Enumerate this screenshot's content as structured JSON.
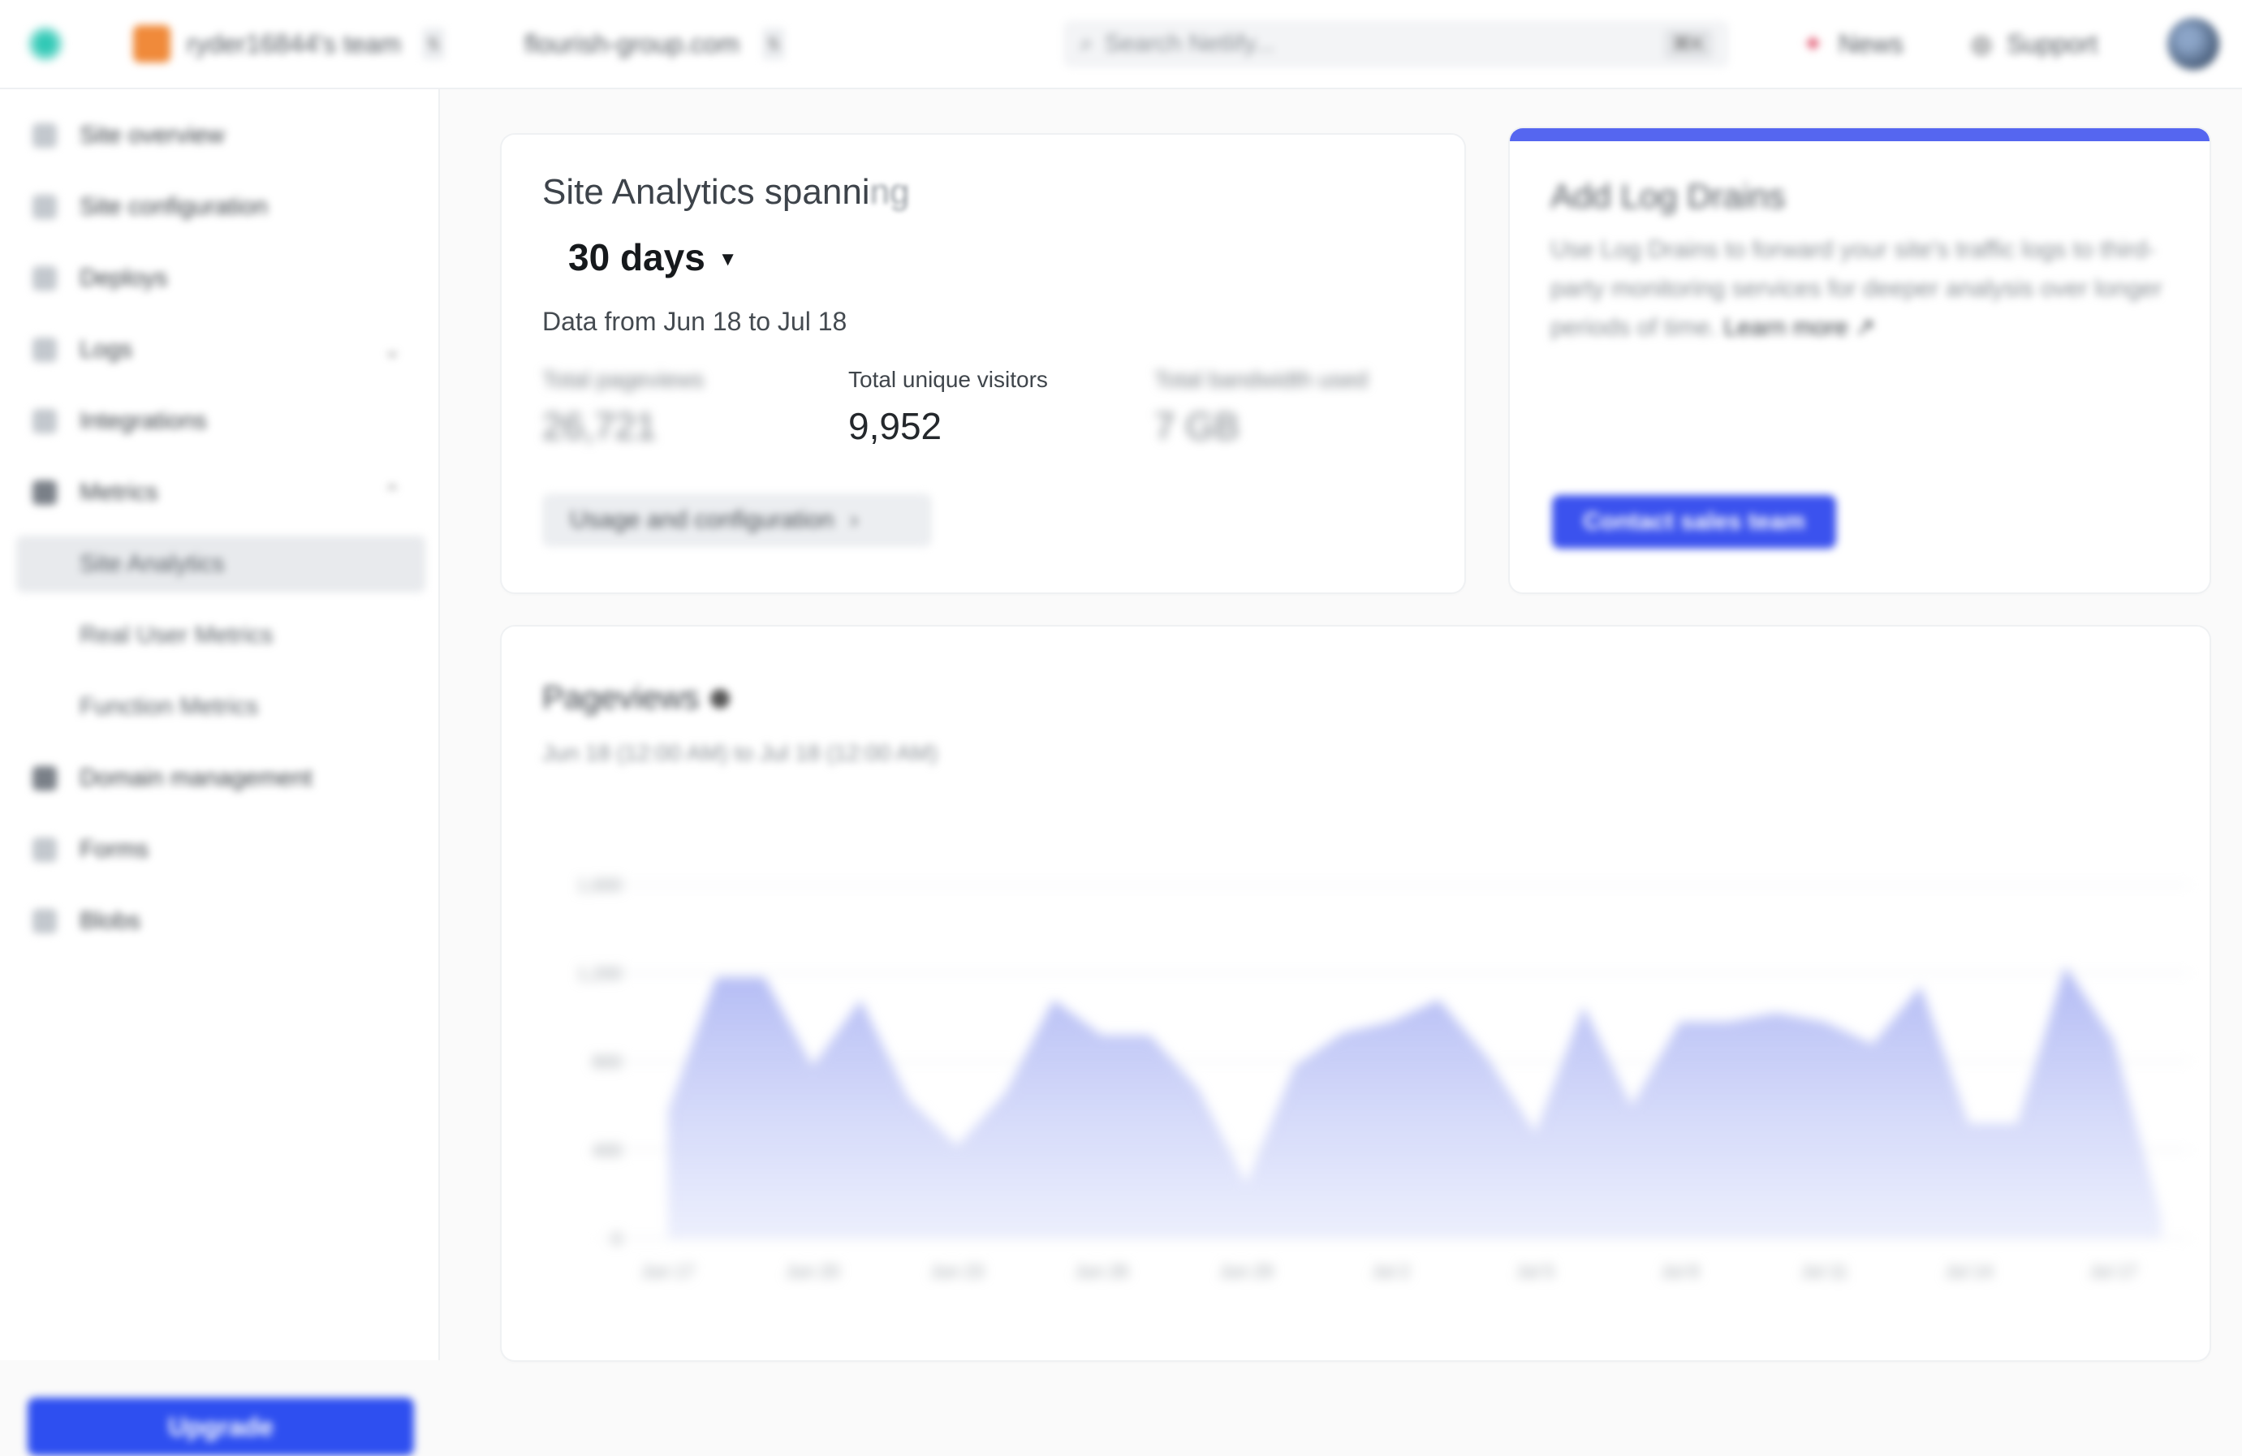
{
  "topbar": {
    "team_name": "ryder16844's team",
    "site_name": "flourish-group.com",
    "search_placeholder": "Search Netlify...",
    "search_shortcut": "⌘K",
    "news_label": "News",
    "support_label": "Support"
  },
  "sidebar": {
    "items": [
      {
        "label": "Site overview"
      },
      {
        "label": "Site configuration"
      },
      {
        "label": "Deploys"
      },
      {
        "label": "Logs"
      },
      {
        "label": "Integrations"
      },
      {
        "label": "Metrics"
      },
      {
        "label": "Site Analytics"
      },
      {
        "label": "Real User Metrics"
      },
      {
        "label": "Function Metrics"
      },
      {
        "label": "Domain management"
      },
      {
        "label": "Forms"
      },
      {
        "label": "Blobs"
      }
    ],
    "upgrade_label": "Upgrade"
  },
  "analytics": {
    "title_visible": "Site Analytics spanni",
    "title_faded": "ng",
    "range_label": "30 days",
    "subtitle": "Data from Jun 18 to Jul 18",
    "stats": [
      {
        "label": "Total pageviews",
        "value": "26,721"
      },
      {
        "label": "Total unique visitors",
        "value": "9,952"
      },
      {
        "label": "Total bandwidth used",
        "value": "7 GB"
      }
    ],
    "usage_button": "Usage and configuration"
  },
  "log_drains": {
    "title": "Add Log Drains",
    "description": "Use Log Drains to forward your site's traffic logs to third-party monitoring services for deeper analysis over longer periods of time.",
    "learn_more": "Learn more ↗",
    "button": "Contact sales team"
  },
  "pageviews": {
    "title": "Pageviews",
    "subtitle": "Jun 18 (12:00 AM) to Jul 18 (12:00 AM)"
  },
  "chart_data": {
    "type": "area",
    "title": "Pageviews",
    "x": [
      "Jun 17",
      "Jun 18",
      "Jun 19",
      "Jun 20",
      "Jun 21",
      "Jun 22",
      "Jun 23",
      "Jun 24",
      "Jun 25",
      "Jun 26",
      "Jun 27",
      "Jun 28",
      "Jun 29",
      "Jun 30",
      "Jul 1",
      "Jul 2",
      "Jul 3",
      "Jul 4",
      "Jul 5",
      "Jul 6",
      "Jul 7",
      "Jul 8",
      "Jul 9",
      "Jul 10",
      "Jul 11",
      "Jul 12",
      "Jul 13",
      "Jul 14",
      "Jul 15",
      "Jul 16",
      "Jul 17",
      "Jul 18"
    ],
    "values": [
      580,
      1180,
      1180,
      780,
      1080,
      630,
      420,
      660,
      1080,
      920,
      920,
      680,
      250,
      780,
      930,
      980,
      1080,
      820,
      480,
      1050,
      600,
      980,
      980,
      1020,
      980,
      880,
      1140,
      520,
      520,
      1230,
      900,
      90
    ],
    "x_tick_labels": [
      "Jun 17",
      "Jun 20",
      "Jun 23",
      "Jun 26",
      "Jun 29",
      "Jul 2",
      "Jul 5",
      "Jul 8",
      "Jul 11",
      "Jul 14",
      "Jul 17"
    ],
    "y_ticks": [
      0,
      400,
      800,
      1200,
      1600
    ],
    "y_tick_labels": [
      "0",
      "400",
      "800",
      "1,200",
      "1,600"
    ],
    "ylim": [
      0,
      1600
    ],
    "grid": true,
    "fill_color": "#b8c0f5"
  }
}
